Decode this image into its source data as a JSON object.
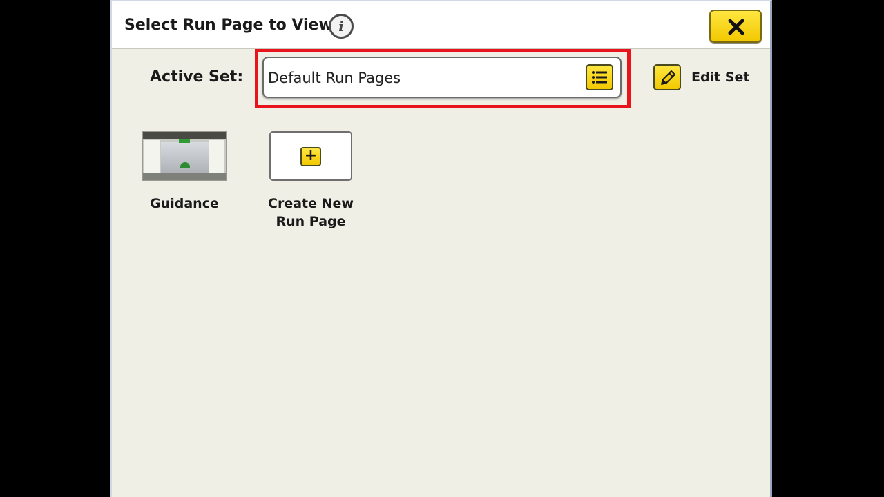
{
  "dialog": {
    "title": "Select Run Page to View",
    "info_icon": "info-icon",
    "info_glyph": "i",
    "close_icon": "close-x-icon"
  },
  "active_set": {
    "label": "Active Set:",
    "value": "Default Run Pages",
    "list_icon": "list-icon",
    "edit_icon": "pencil-icon",
    "edit_label": "Edit Set"
  },
  "run_pages": [
    {
      "label": "Guidance",
      "icon": "guidance-thumbnail"
    },
    {
      "label_line1": "Create New",
      "label_line2": "Run Page",
      "icon": "plus-icon",
      "glyph": "+"
    }
  ],
  "colors": {
    "accent_yellow": "#f2c800",
    "highlight_red": "#e8131b",
    "background": "#efefe6"
  }
}
